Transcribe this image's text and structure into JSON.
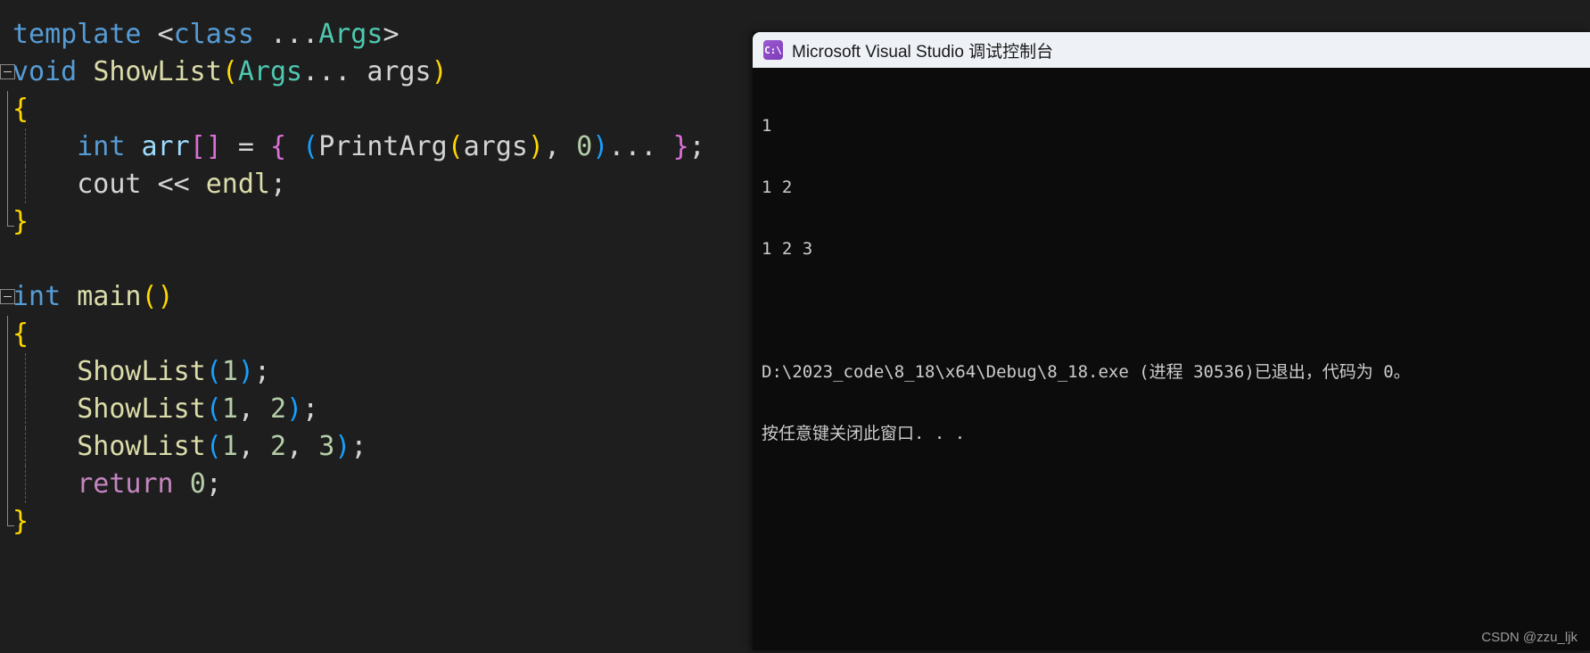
{
  "editor": {
    "background": "#1e1e1e",
    "foreground": "#d4d4d4",
    "lines": [
      {
        "gutter": "none",
        "indent": false,
        "text": "template <class ...Args>"
      },
      {
        "gutter": "fold-open",
        "indent": false,
        "text": "void ShowList(Args... args)"
      },
      {
        "gutter": "bar",
        "indent": false,
        "text": "{"
      },
      {
        "gutter": "bar",
        "indent": true,
        "text": "    int arr[] = { (PrintArg(args), 0)... };"
      },
      {
        "gutter": "bar",
        "indent": true,
        "text": "    cout << endl;"
      },
      {
        "gutter": "bar-end",
        "indent": false,
        "text": "}"
      },
      {
        "gutter": "none",
        "indent": false,
        "text": ""
      },
      {
        "gutter": "fold-open",
        "indent": false,
        "text": "int main()"
      },
      {
        "gutter": "bar",
        "indent": false,
        "text": "{"
      },
      {
        "gutter": "bar",
        "indent": true,
        "text": "    ShowList(1);"
      },
      {
        "gutter": "bar",
        "indent": true,
        "text": "    ShowList(1, 2);"
      },
      {
        "gutter": "bar",
        "indent": true,
        "text": "    ShowList(1, 2, 3);"
      },
      {
        "gutter": "bar",
        "indent": true,
        "text": "    return 0;"
      },
      {
        "gutter": "bar-end",
        "indent": false,
        "text": "}"
      }
    ],
    "token_colors": {
      "keyword": "#569cd6",
      "control": "#c586c0",
      "type": "#4ec9b0",
      "function": "#dcdcaa",
      "number": "#b5cea8",
      "variable": "#9cdcfe",
      "plain": "#d4d4d4"
    }
  },
  "console": {
    "title": "Microsoft Visual Studio 调试控制台",
    "icon_label": "C:\\",
    "titlebar_color": "#eef1f6",
    "background": "#0c0c0c",
    "foreground": "#cccccc",
    "output_lines": [
      "1",
      "1 2",
      "1 2 3",
      "",
      "D:\\2023_code\\8_18\\x64\\Debug\\8_18.exe (进程 30536)已退出，代码为 0。",
      "按任意键关闭此窗口. . ."
    ]
  },
  "watermark": {
    "text": "CSDN @zzu_ljk"
  }
}
